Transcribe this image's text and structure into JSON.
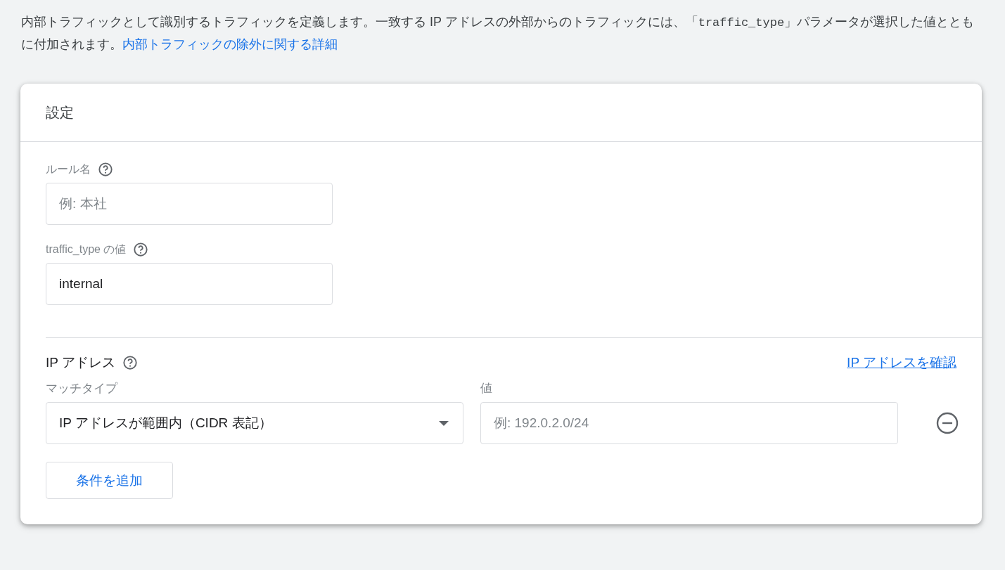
{
  "intro": {
    "text_before": "内部トラフィックとして識別するトラフィックを定義します。一致する IP アドレスの外部からのトラフィックには、「",
    "code": "traffic_type",
    "text_after": "」パラメータが選択した値とともに付加されます。",
    "link": "内部トラフィックの除外に関する詳細"
  },
  "card": {
    "title": "設定",
    "fields": [
      {
        "label": "ルール名",
        "placeholder": "例: 本社"
      },
      {
        "label": "traffic_type の値",
        "value": "internal"
      }
    ],
    "ip_section": {
      "title": "IP アドレス",
      "check_link": "IP アドレスを確認",
      "match_label": "マッチタイプ",
      "value_label": "値",
      "conditions": [
        {
          "match_type": "IP アドレスが範囲内（CIDR 表記）",
          "placeholder": "例: 192.0.2.0/24"
        }
      ],
      "add_button": "条件を追加"
    }
  }
}
